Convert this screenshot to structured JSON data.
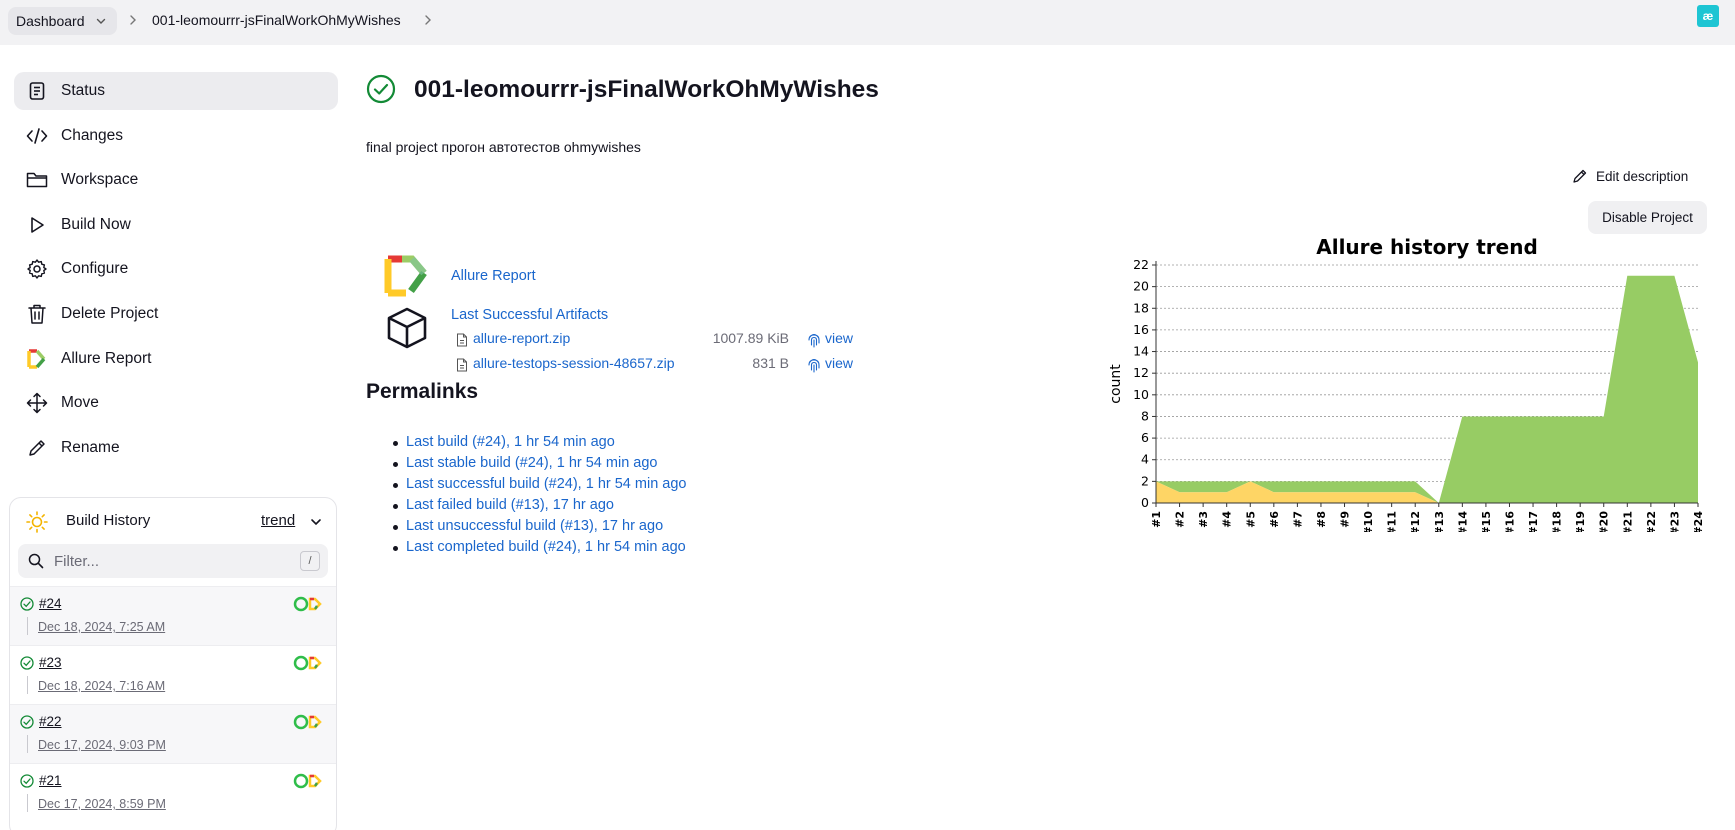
{
  "breadcrumb": {
    "dashboard": "Dashboard",
    "job": "001-leomourrr-jsFinalWorkOhMyWishes"
  },
  "brand": {
    "logo_text": "æ"
  },
  "sidebar": {
    "items": [
      {
        "label": "Status",
        "icon": "document-icon"
      },
      {
        "label": "Changes",
        "icon": "code-icon"
      },
      {
        "label": "Workspace",
        "icon": "folder-icon"
      },
      {
        "label": "Build Now",
        "icon": "play-icon"
      },
      {
        "label": "Configure",
        "icon": "gear-icon"
      },
      {
        "label": "Delete Project",
        "icon": "trash-icon"
      },
      {
        "label": "Allure Report",
        "icon": "allure-icon"
      },
      {
        "label": "Move",
        "icon": "move-icon"
      },
      {
        "label": "Rename",
        "icon": "pencil-icon"
      }
    ]
  },
  "history": {
    "title": "Build History",
    "trend": "trend",
    "filter_placeholder": "Filter...",
    "shortcut": "/",
    "builds": [
      {
        "num": "#24",
        "date": "Dec 18, 2024, 7:25 AM"
      },
      {
        "num": "#23",
        "date": "Dec 18, 2024, 7:16 AM"
      },
      {
        "num": "#22",
        "date": "Dec 17, 2024, 9:03 PM"
      },
      {
        "num": "#21",
        "date": "Dec 17, 2024, 8:59 PM"
      }
    ]
  },
  "main": {
    "title": "001-leomourrr-jsFinalWorkOhMyWishes",
    "description": "final project прогон автотестов ohmywishes",
    "edit_description": "Edit description",
    "disable_project": "Disable Project",
    "allure_report": "Allure Report",
    "last_successful_artifacts": "Last Successful Artifacts",
    "artifacts": [
      {
        "name": "allure-report.zip",
        "size": "1007.89 KiB",
        "view": "view"
      },
      {
        "name": "allure-testops-session-48657.zip",
        "size": "831 B",
        "view": "view"
      }
    ],
    "permalinks_title": "Permalinks",
    "permalinks": [
      "Last build (#24), 1 hr 54 min ago",
      "Last stable build (#24), 1 hr 54 min ago",
      "Last successful build (#24), 1 hr 54 min ago",
      "Last failed build (#13), 17 hr ago",
      "Last unsuccessful build (#13), 17 hr ago",
      "Last completed build (#24), 1 hr 54 min ago"
    ]
  },
  "colors": {
    "link": "#1a66cc",
    "success": "#138a36",
    "passed": "#97cc64",
    "broken": "#fed565"
  },
  "chart_data": {
    "type": "area",
    "title": "Allure history trend",
    "ylabel": "count",
    "xlabel": "",
    "ylim": [
      0,
      22
    ],
    "yticks": [
      0,
      2,
      4,
      6,
      8,
      10,
      12,
      14,
      16,
      18,
      20,
      22
    ],
    "grid": true,
    "categories": [
      "#1",
      "#2",
      "#3",
      "#4",
      "#5",
      "#6",
      "#7",
      "#8",
      "#9",
      "#10",
      "#11",
      "#12",
      "#13",
      "#14",
      "#15",
      "#16",
      "#17",
      "#18",
      "#19",
      "#20",
      "#21",
      "#22",
      "#23",
      "#24"
    ],
    "series": [
      {
        "values": [
          2,
          1,
          1,
          1,
          2,
          1,
          1,
          1,
          1,
          1,
          1,
          1,
          0,
          0,
          0,
          0,
          0,
          0,
          0,
          0,
          0,
          0,
          0,
          0
        ],
        "color": "#fed565"
      },
      {
        "values": [
          0,
          1,
          1,
          1,
          0,
          1,
          1,
          1,
          1,
          1,
          1,
          1,
          0,
          8,
          8,
          8,
          8,
          8,
          8,
          8,
          21,
          21,
          21,
          13
        ],
        "color": "#97cc64"
      }
    ]
  }
}
